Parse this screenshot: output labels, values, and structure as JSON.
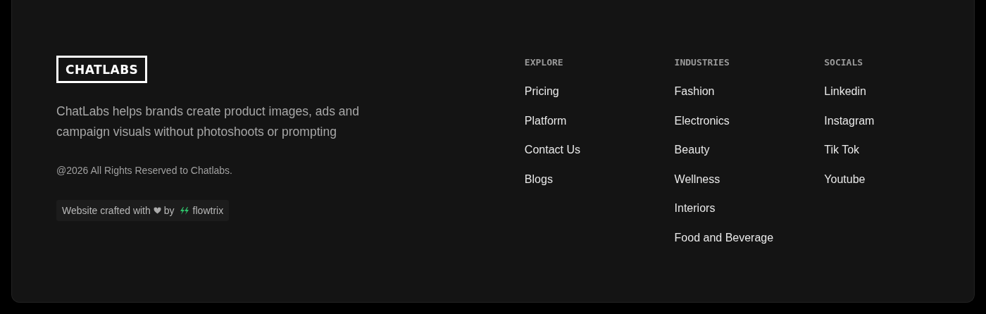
{
  "brand": {
    "logo": "CHATLABS",
    "description": "ChatLabs helps brands create product images, ads and campaign visuals without photoshoots or prompting",
    "copyright": "@2026 All Rights Reserved to Chatlabs."
  },
  "credit": {
    "prefix": "Website crafted with",
    "middle": "by",
    "brand": "flowtrix"
  },
  "columns": [
    {
      "heading": "EXPLORE",
      "links": [
        "Pricing",
        "Platform",
        "Contact Us",
        "Blogs"
      ]
    },
    {
      "heading": "INDUSTRIES",
      "links": [
        "Fashion",
        "Electronics",
        "Beauty",
        "Wellness",
        "Interiors",
        "Food and Beverage"
      ]
    },
    {
      "heading": "SOCIALS",
      "links": [
        "Linkedin",
        "Instagram",
        "Tik Tok",
        "Youtube"
      ]
    }
  ]
}
